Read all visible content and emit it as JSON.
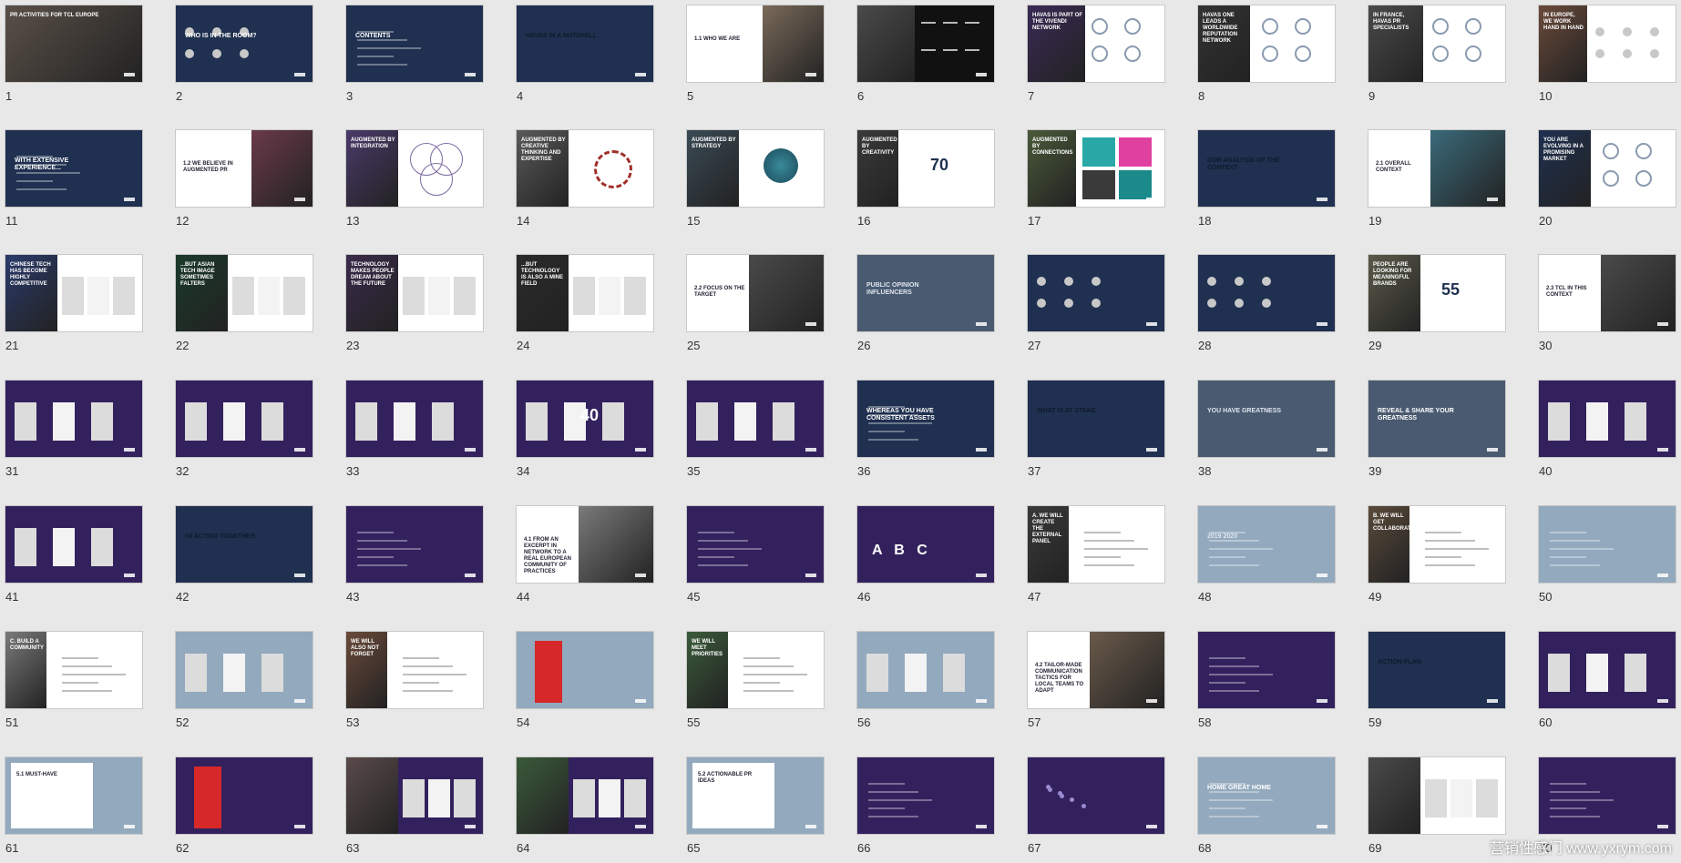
{
  "slides": [
    {
      "num": "1",
      "bg": "#3a3f49",
      "title": "PR ACTIVITIES FOR TCL EUROPE",
      "tc": "#ffffff",
      "photo": "#5a5048",
      "pl": 0,
      "pw": 100
    },
    {
      "num": "2",
      "bg": "#1f3050",
      "title": "WHO IS IN THE ROOM?",
      "tc": "#ffffff",
      "dots": true
    },
    {
      "num": "3",
      "bg": "#1f3050",
      "title": "CONTENTS",
      "tc": "#ffffff",
      "lines": true
    },
    {
      "num": "4",
      "bg": "#1f3050",
      "title": "HAVAS IN A NUTSHELL",
      "tc": "#0f1a2c"
    },
    {
      "num": "5",
      "bg": "#ffffff",
      "title": "1.1 WHO WE ARE",
      "tc": "#223",
      "photo": "#7a6a5a",
      "pl": 55,
      "pw": 45
    },
    {
      "num": "6",
      "bg": "#111111",
      "title": "",
      "tc": "#ffffff",
      "photo": "#4a4a4a",
      "pl": 0,
      "pw": 42,
      "stats": true
    },
    {
      "num": "7",
      "bg": "#ffffff",
      "title": "HAVAS IS PART OF THE VIVENDI NETWORK",
      "tc": "#ffffff",
      "photo": "#3a2a55",
      "pl": 0,
      "pw": 42,
      "rings": true
    },
    {
      "num": "8",
      "bg": "#ffffff",
      "title": "HAVAS ONE LEADS A WORLDWIDE REPUTATION NETWORK",
      "tc": "#ffffff",
      "photo": "#333333",
      "pl": 0,
      "pw": 38,
      "rings": true
    },
    {
      "num": "9",
      "bg": "#ffffff",
      "title": "IN FRANCE, HAVAS PR SPECIALISTS",
      "tc": "#ffffff",
      "photo": "#4a4a4a",
      "pl": 0,
      "pw": 40,
      "rings": true
    },
    {
      "num": "10",
      "bg": "#ffffff",
      "title": "IN EUROPE, WE WORK HAND IN HAND",
      "tc": "#ffffff",
      "photo": "#6a4a3a",
      "pl": 0,
      "pw": 35,
      "dots": true
    },
    {
      "num": "11",
      "bg": "#1f3050",
      "title": "WITH EXTENSIVE EXPERIENCE...",
      "tc": "#ffffff",
      "lines": true
    },
    {
      "num": "12",
      "bg": "#ffffff",
      "title": "1.2 WE BELIEVE IN AUGMENTED PR",
      "tc": "#223",
      "photo": "#6a3a4a",
      "pl": 55,
      "pw": 45
    },
    {
      "num": "13",
      "bg": "#ffffff",
      "title": "AUGMENTED BY INTEGRATION",
      "tc": "#ffffff",
      "photo": "#4a3a6a",
      "pl": 0,
      "pw": 38,
      "venn": true
    },
    {
      "num": "14",
      "bg": "#ffffff",
      "title": "AUGMENTED BY CREATIVE THINKING AND EXPERTISE",
      "tc": "#ffffff",
      "photo": "#5a5a5a",
      "pl": 0,
      "pw": 38,
      "wheel": true
    },
    {
      "num": "15",
      "bg": "#ffffff",
      "title": "AUGMENTED BY STRATEGY",
      "tc": "#ffffff",
      "photo": "#3a4a55",
      "pl": 0,
      "pw": 38,
      "teal": true
    },
    {
      "num": "16",
      "bg": "#ffffff",
      "title": "AUGMENTED BY CREATIVITY",
      "tc": "#ffffff",
      "photo": "#3a3a3a",
      "pl": 0,
      "pw": 30,
      "big": "70"
    },
    {
      "num": "17",
      "bg": "#ffffff",
      "title": "AUGMENTED BY CONNECTIONS",
      "tc": "#ffffff",
      "photo": "#4a5a3a",
      "pl": 0,
      "pw": 35,
      "tiles": true
    },
    {
      "num": "18",
      "bg": "#1f3050",
      "title": "OUR ANALYSIS OF THE CONTEXT",
      "tc": "#0f1a2c"
    },
    {
      "num": "19",
      "bg": "#ffffff",
      "title": "2.1 OVERALL CONTEXT",
      "tc": "#223",
      "photo": "#3a6a7a",
      "pl": 45,
      "pw": 55
    },
    {
      "num": "20",
      "bg": "#ffffff",
      "title": "YOU ARE EVOLVING IN A PROMISING MARKET",
      "tc": "#ffffff",
      "photo": "#1f3050",
      "pl": 0,
      "pw": 38,
      "rings": true
    },
    {
      "num": "21",
      "bg": "#ffffff",
      "title": "CHINESE TECH HAS BECOME HIGHLY COMPETITIVE",
      "tc": "#ffffff",
      "photo": "#2a3a6a",
      "pl": 0,
      "pw": 38,
      "docs": true
    },
    {
      "num": "22",
      "bg": "#ffffff",
      "title": "...BUT ASIAN TECH IMAGE SOMETIMES FALTERS",
      "tc": "#ffffff",
      "photo": "#1a3a2a",
      "pl": 0,
      "pw": 38,
      "docs": true
    },
    {
      "num": "23",
      "bg": "#ffffff",
      "title": "TECHNOLOGY MAKES PEOPLE DREAM ABOUT THE FUTURE",
      "tc": "#ffffff",
      "photo": "#3a2a4a",
      "pl": 0,
      "pw": 38,
      "docs": true
    },
    {
      "num": "24",
      "bg": "#ffffff",
      "title": "...BUT TECHNOLOGY IS ALSO A MINE FIELD",
      "tc": "#ffffff",
      "photo": "#2a2a2a",
      "pl": 0,
      "pw": 38,
      "docs": true
    },
    {
      "num": "25",
      "bg": "#ffffff",
      "title": "2.2 FOCUS ON THE TARGET",
      "tc": "#223",
      "photo": "#4a4a4a",
      "pl": 45,
      "pw": 55
    },
    {
      "num": "26",
      "bg": "#4a5a70",
      "title": "PUBLIC OPINION INFLUENCERS",
      "tc": "#dfe6ef"
    },
    {
      "num": "27",
      "bg": "#1f3050",
      "title": "",
      "tc": "#ffffff",
      "dots": true
    },
    {
      "num": "28",
      "bg": "#1f3050",
      "title": "",
      "tc": "#ffffff",
      "dots": true
    },
    {
      "num": "29",
      "bg": "#ffffff",
      "title": "PEOPLE ARE LOOKING FOR MEANINGFUL BRANDS",
      "tc": "#ffffff",
      "photo": "#5a5a4a",
      "pl": 0,
      "pw": 38,
      "big": "55"
    },
    {
      "num": "30",
      "bg": "#ffffff",
      "title": "2.3 TCL IN THIS CONTEXT",
      "tc": "#223",
      "photo": "#4a4a4a",
      "pl": 45,
      "pw": 55
    },
    {
      "num": "31",
      "bg": "#33215e",
      "title": "",
      "tc": "#ffffff",
      "docs": true
    },
    {
      "num": "32",
      "bg": "#33215e",
      "title": "",
      "tc": "#ffffff",
      "docs": true
    },
    {
      "num": "33",
      "bg": "#33215e",
      "title": "",
      "tc": "#ffffff",
      "docs": true
    },
    {
      "num": "34",
      "bg": "#33215e",
      "title": "",
      "tc": "#ffffff",
      "docs": true,
      "big": "40"
    },
    {
      "num": "35",
      "bg": "#33215e",
      "title": "",
      "tc": "#ffffff",
      "docs": true
    },
    {
      "num": "36",
      "bg": "#1f3050",
      "title": "WHEREAS YOU HAVE CONSISTENT ASSETS",
      "tc": "#ffffff",
      "lines": true
    },
    {
      "num": "37",
      "bg": "#1f3050",
      "title": "WHAT IS AT STAKE",
      "tc": "#0f1a2c"
    },
    {
      "num": "38",
      "bg": "#4a5a70",
      "title": "YOU HAVE GREATNESS",
      "tc": "#dfe6ef"
    },
    {
      "num": "39",
      "bg": "#4a5a70",
      "title": "REVEAL & SHARE YOUR GREATNESS",
      "tc": "#ffffff"
    },
    {
      "num": "40",
      "bg": "#33215e",
      "title": "",
      "tc": "#ffffff",
      "docs": true
    },
    {
      "num": "41",
      "bg": "#33215e",
      "title": "",
      "tc": "#ffffff",
      "docs": true
    },
    {
      "num": "42",
      "bg": "#1f3050",
      "title": "04 ACTING TOGETHER",
      "tc": "#0f1a2c"
    },
    {
      "num": "43",
      "bg": "#33215e",
      "title": "",
      "tc": "#ffffff",
      "lines": true
    },
    {
      "num": "44",
      "bg": "#ffffff",
      "title": "4.1 FROM AN EXCERPT IN NETWORK TO A REAL EUROPEAN COMMUNITY OF PRACTICES",
      "tc": "#223",
      "photo": "#7a7a7a",
      "pl": 45,
      "pw": 55
    },
    {
      "num": "45",
      "bg": "#33215e",
      "title": "",
      "tc": "#ffffff",
      "lines": true
    },
    {
      "num": "46",
      "bg": "#33215e",
      "title": "A   B   C",
      "tc": "#ffffff",
      "abc": true
    },
    {
      "num": "47",
      "bg": "#ffffff",
      "title": "A. WE WILL CREATE THE EXTERNAL PANEL",
      "tc": "#ffffff",
      "photo": "#3a3a3a",
      "pl": 0,
      "pw": 30,
      "lines": true
    },
    {
      "num": "48",
      "bg": "#93a9bd",
      "title": "2019 2020",
      "tc": "#dfe6ef",
      "lines": true
    },
    {
      "num": "49",
      "bg": "#ffffff",
      "title": "B. WE WILL GET COLLABORATION",
      "tc": "#ffffff",
      "photo": "#5a4a3a",
      "pl": 0,
      "pw": 30,
      "lines": true
    },
    {
      "num": "50",
      "bg": "#93a9bd",
      "title": "",
      "tc": "#ffffff",
      "lines": true
    },
    {
      "num": "51",
      "bg": "#ffffff",
      "title": "C. BUILD A COMMUNITY",
      "tc": "#ffffff",
      "photo": "#7a7a7a",
      "pl": 0,
      "pw": 30,
      "lines": true
    },
    {
      "num": "52",
      "bg": "#93a9bd",
      "title": "",
      "tc": "#ffffff",
      "docs": true
    },
    {
      "num": "53",
      "bg": "#ffffff",
      "title": "WE WILL ALSO NOT FORGET",
      "tc": "#ffffff",
      "photo": "#6a4a3a",
      "pl": 0,
      "pw": 30,
      "lines": true
    },
    {
      "num": "54",
      "bg": "#93a9bd",
      "title": "",
      "tc": "#ffffff",
      "red": true
    },
    {
      "num": "55",
      "bg": "#ffffff",
      "title": "WE WILL MEET PRIORITIES",
      "tc": "#ffffff",
      "photo": "#3a5a3a",
      "pl": 0,
      "pw": 30,
      "lines": true
    },
    {
      "num": "56",
      "bg": "#93a9bd",
      "title": "",
      "tc": "#ffffff",
      "docs": true
    },
    {
      "num": "57",
      "bg": "#ffffff",
      "title": "4.2 TAILOR-MADE COMMUNICATION TACTICS FOR LOCAL TEAMS TO ADAPT",
      "tc": "#223",
      "photo": "#6a5a4a",
      "pl": 45,
      "pw": 55
    },
    {
      "num": "58",
      "bg": "#33215e",
      "title": "",
      "tc": "#ffffff",
      "lines": true
    },
    {
      "num": "59",
      "bg": "#1f3050",
      "title": "ACTION PLAN",
      "tc": "#0f1a2c"
    },
    {
      "num": "60",
      "bg": "#33215e",
      "title": "",
      "tc": "#ffffff",
      "docs": true
    },
    {
      "num": "61",
      "bg": "#93a9bd",
      "title": "5.1 MUST-HAVE",
      "tc": "#223",
      "whitebox": true
    },
    {
      "num": "62",
      "bg": "#33215e",
      "title": "",
      "tc": "#ffffff",
      "red": true
    },
    {
      "num": "63",
      "bg": "#33215e",
      "title": "",
      "tc": "#ffffff",
      "photo": "#5a4a4a",
      "pl": 0,
      "pw": 38,
      "docs": true
    },
    {
      "num": "64",
      "bg": "#33215e",
      "title": "",
      "tc": "#ffffff",
      "photo": "#3a5a3a",
      "pl": 0,
      "pw": 38,
      "docs": true
    },
    {
      "num": "65",
      "bg": "#93a9bd",
      "title": "5.2 ACTIONABLE PR IDEAS",
      "tc": "#223",
      "whitebox": true
    },
    {
      "num": "66",
      "bg": "#33215e",
      "title": "",
      "tc": "#ffffff",
      "lines": true
    },
    {
      "num": "67",
      "bg": "#33215e",
      "title": "",
      "tc": "#ffffff",
      "network": true
    },
    {
      "num": "68",
      "bg": "#93a9bd",
      "title": "HOME GREAT HOME",
      "tc": "#ffffff",
      "lines": true
    },
    {
      "num": "69",
      "bg": "#ffffff",
      "title": "",
      "tc": "#ffffff",
      "photo": "#4a4a4a",
      "pl": 0,
      "pw": 38,
      "docs": true
    },
    {
      "num": "70",
      "bg": "#33215e",
      "title": "",
      "tc": "#ffffff",
      "lines": true
    }
  ],
  "watermark": "营销性感门 www.yxrym.com"
}
